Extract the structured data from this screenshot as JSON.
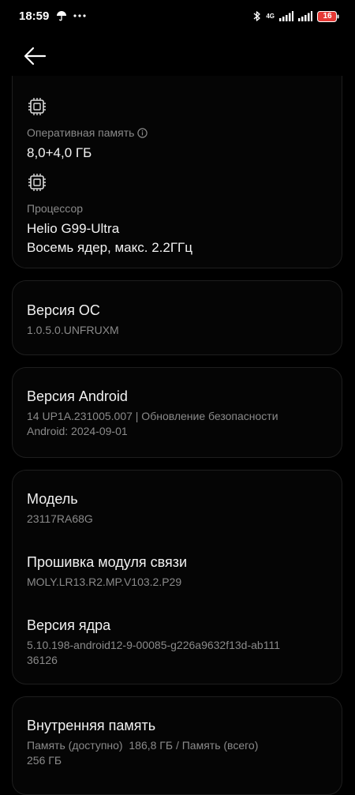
{
  "status_bar": {
    "time": "18:59",
    "network_label": "4G",
    "battery_level": "16"
  },
  "hardware": {
    "ram_label": "Оперативная память",
    "ram_value": "8,0+4,0 ГБ",
    "cpu_label": "Процессор",
    "cpu_name": "Helio G99-Ultra",
    "cpu_desc": "Восемь ядер, макс. 2.2ГГц"
  },
  "os": {
    "title": "Версия ОС",
    "value": "1.0.5.0.UNFRUXM"
  },
  "android": {
    "title": "Версия Android",
    "value_line1": "14 UP1A.231005.007 | Обновление безопасности",
    "value_line2": "Android: 2024-09-01"
  },
  "model": {
    "model_title": "Модель",
    "model_value": "23117RA68G",
    "baseband_title": "Прошивка модуля связи",
    "baseband_value": "MOLY.LR13.R2.MP.V103.2.P29",
    "kernel_title": "Версия ядра",
    "kernel_value_line1": "5.10.198-android12-9-00085-g226a9632f13d-ab111",
    "kernel_value_line2": "36126"
  },
  "storage": {
    "title": "Внутренняя память",
    "value_line1": "Память (доступно)  186,8 ГБ / Память (всего)",
    "value_line2": "256 ГБ"
  },
  "colors": {
    "background": "#000000",
    "card_border": "#1e1e1e",
    "primary_text": "#f2f2f2",
    "secondary_text": "#8a8a8a",
    "battery_low": "#e53935"
  },
  "icons": {
    "back": "arrow-left-icon",
    "ram": "chip-icon",
    "cpu": "processor-icon",
    "info": "info-icon"
  }
}
